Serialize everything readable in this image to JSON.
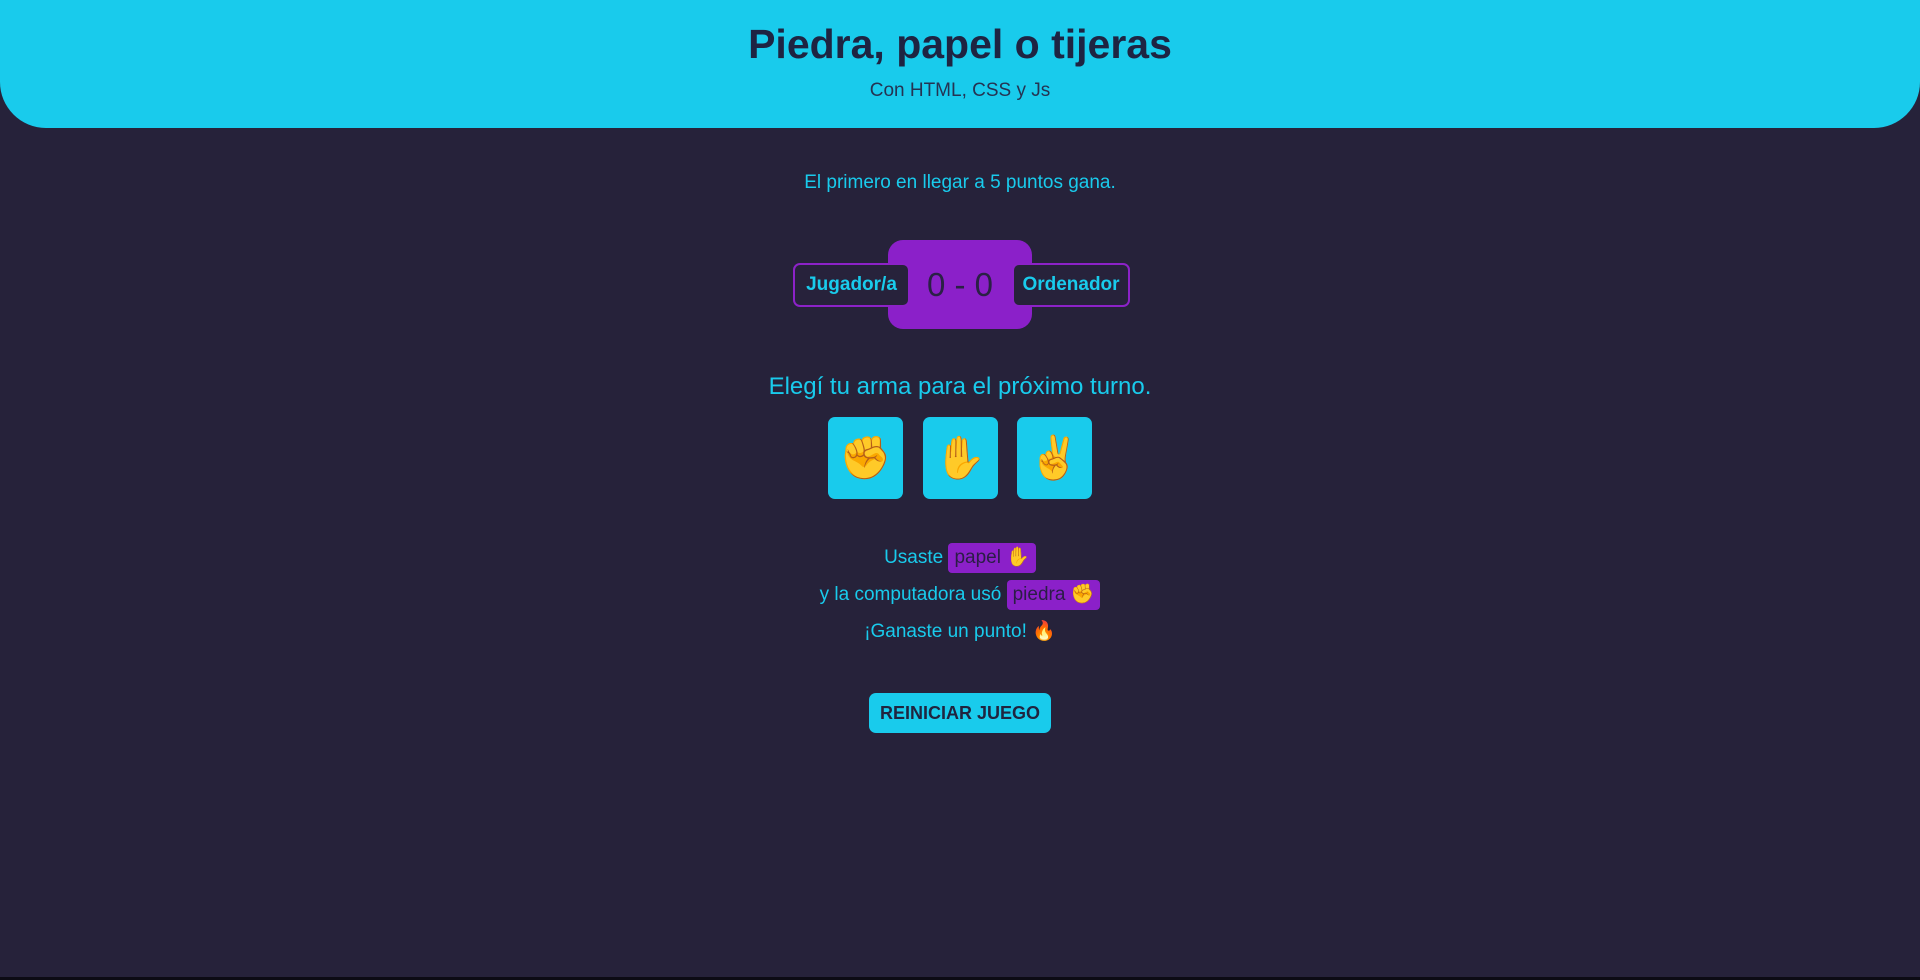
{
  "header": {
    "title": "Piedra, papel o tijeras",
    "subtitle": "Con HTML, CSS y Js"
  },
  "intro": "El primero en llegar a 5 puntos gana.",
  "scoreboard": {
    "player_label": "Jugador/a",
    "computer_label": "Ordenador",
    "score": "0 - 0",
    "player_score": 0,
    "computer_score": 0
  },
  "prompt": "Elegí tu arma para el próximo turno.",
  "weapons": [
    {
      "name": "piedra",
      "icon": "✊"
    },
    {
      "name": "papel",
      "icon": "✋"
    },
    {
      "name": "tijeras",
      "icon": "✌️"
    }
  ],
  "result": {
    "player_prefix": "Usaste",
    "player_choice": "papel ✋",
    "computer_prefix": "y la computadora usó",
    "computer_choice": "piedra ✊",
    "outcome": "¡Ganaste un punto! 🔥"
  },
  "restart_label": "REINICIAR JUEGO",
  "colors": {
    "background": "#26223a",
    "accent": "#19cbec",
    "purple": "#8b20c9",
    "dark_text": "#1e2442"
  }
}
